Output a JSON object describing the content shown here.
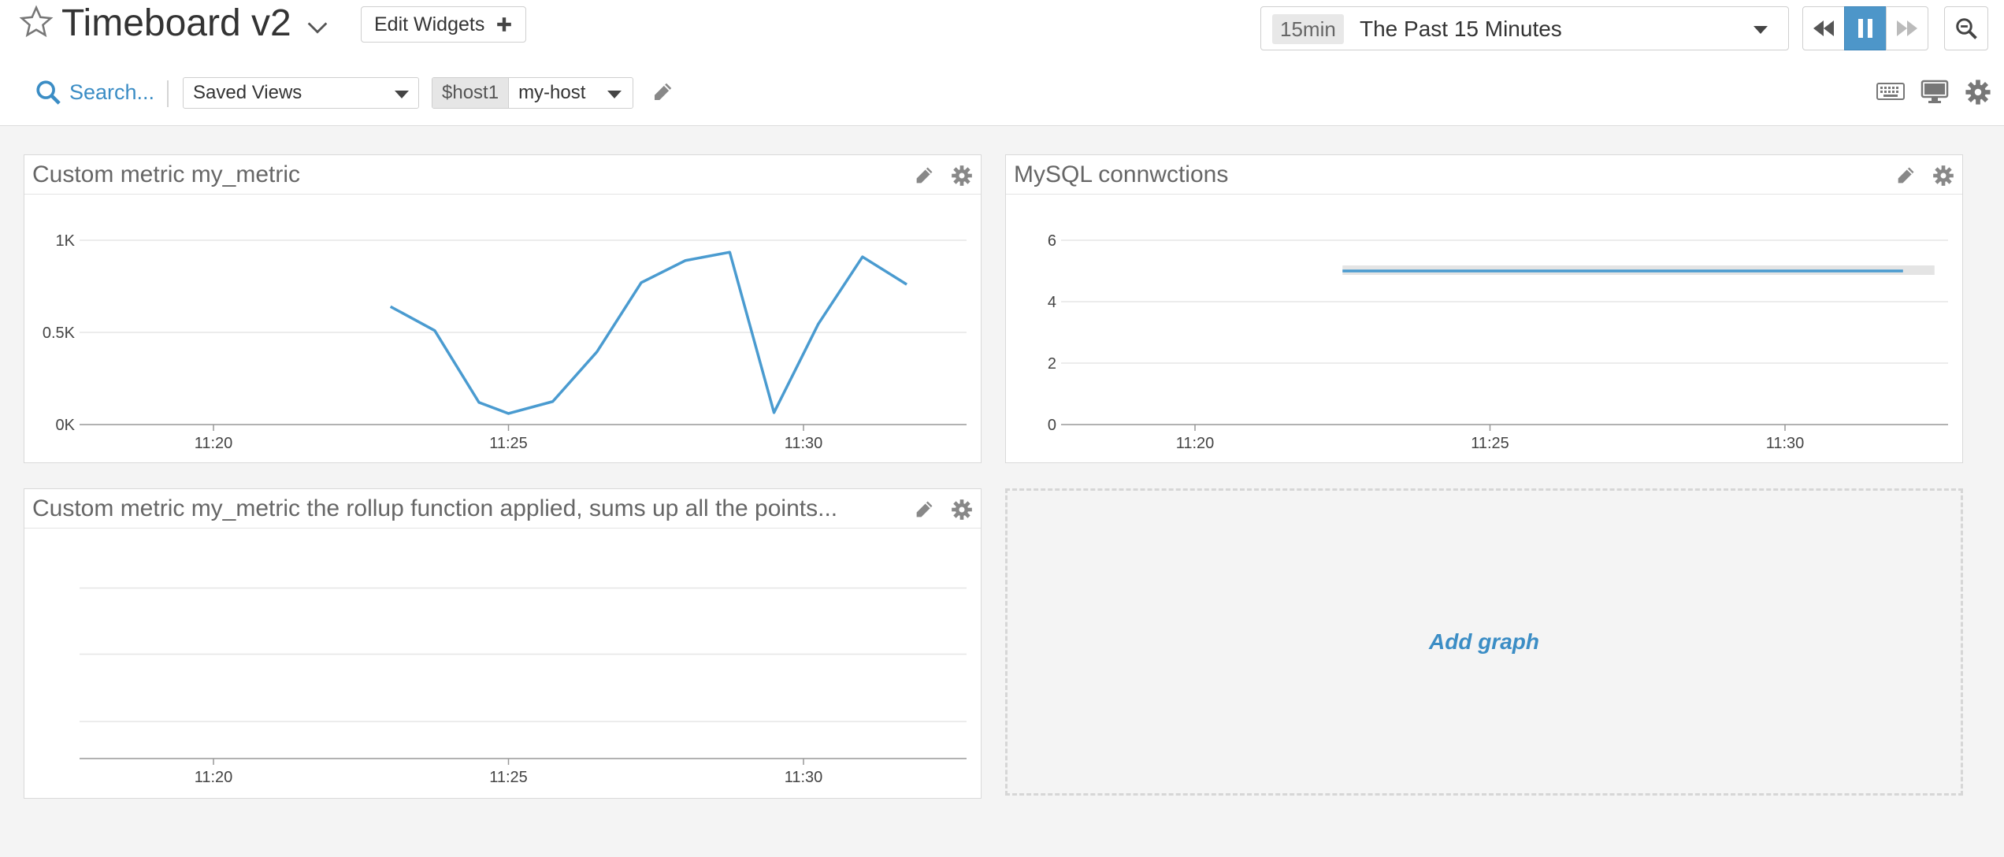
{
  "header": {
    "title": "Timeboard v2",
    "edit_widgets_label": "Edit Widgets",
    "time_range": {
      "badge": "15min",
      "label": "The Past 15 Minutes"
    },
    "search_label": "Search...",
    "saved_views_label": "Saved Views",
    "template_var": {
      "name": "$host1",
      "value": "my-host"
    }
  },
  "widgets": [
    {
      "title": "Custom metric my_metric"
    },
    {
      "title": "MySQL connwctions"
    },
    {
      "title": "Custom metric my_metric the rollup function applied, sums up all the points..."
    }
  ],
  "add_graph_label": "Add graph",
  "colors": {
    "accent": "#4d96c9",
    "link": "#3b8dc5",
    "line": "#4a9bd0"
  },
  "chart_data": [
    {
      "type": "line",
      "title": "Custom metric my_metric",
      "x": [
        "11:23",
        "11:23:45",
        "11:24:30",
        "11:25",
        "11:25:45",
        "11:26:30",
        "11:27:15",
        "11:28",
        "11:28:45",
        "11:29:30",
        "11:30:15",
        "11:31",
        "11:31:45"
      ],
      "y": [
        640,
        510,
        120,
        60,
        125,
        395,
        770,
        890,
        935,
        65,
        545,
        910,
        760
      ],
      "xticks": [
        "11:20",
        "11:25",
        "11:30"
      ],
      "yticks": [
        "0K",
        "0.5K",
        "1K"
      ],
      "ylim": [
        0,
        1000
      ],
      "grid": true
    },
    {
      "type": "line",
      "title": "MySQL connwctions",
      "x": [
        "11:22:30",
        "11:32:00"
      ],
      "y": [
        5,
        5
      ],
      "xticks": [
        "11:20",
        "11:25",
        "11:30"
      ],
      "yticks": [
        "0",
        "2",
        "4",
        "6"
      ],
      "ylim": [
        0,
        6
      ],
      "grid": true
    },
    {
      "type": "line",
      "title": "Custom metric my_metric the rollup function applied, sums up all the points...",
      "x": [],
      "y": [],
      "xticks": [
        "11:20",
        "11:25",
        "11:30"
      ],
      "yticks": [],
      "grid": true
    }
  ]
}
